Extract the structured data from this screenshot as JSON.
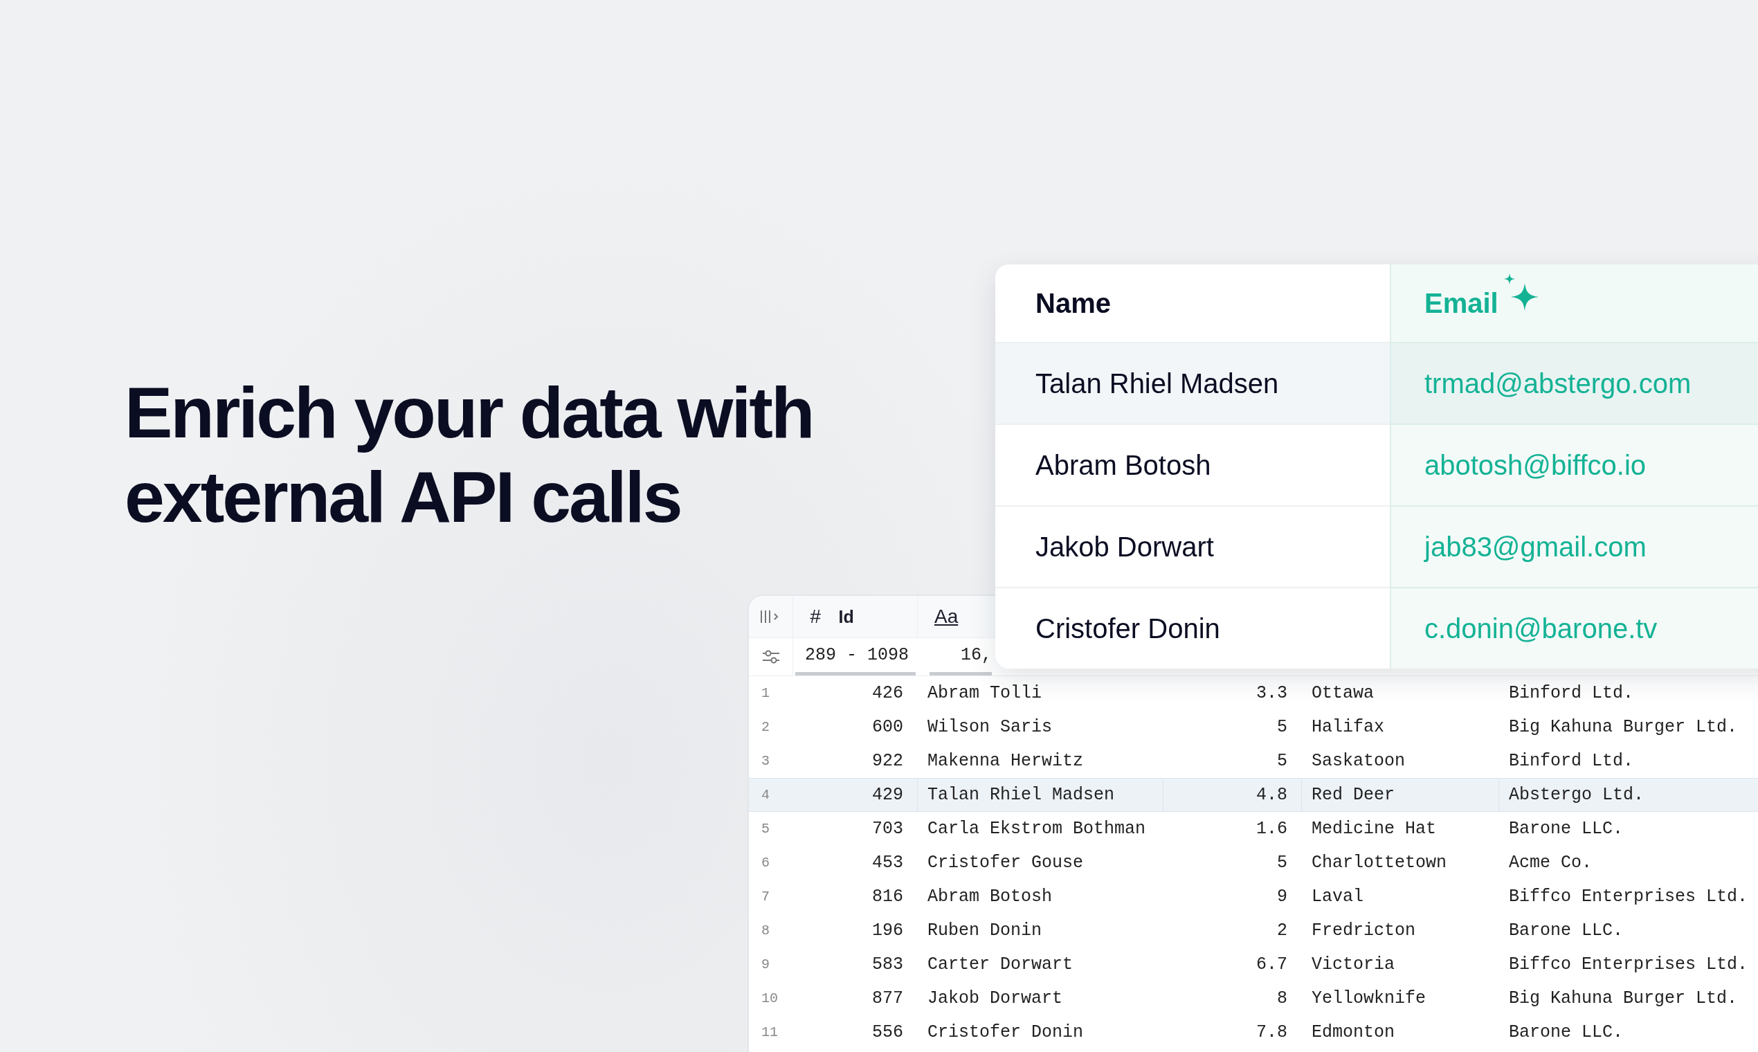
{
  "headline": [
    "Enrich your data with",
    "external API calls"
  ],
  "grid": {
    "header": [
      {
        "kind": "number",
        "type_glyph": "#",
        "label": "Id"
      },
      {
        "kind": "text",
        "type_glyph": "Aa"
      }
    ],
    "filters": [
      "289 - 1098",
      "16,"
    ],
    "rows": [
      {
        "index": "1",
        "id": "426",
        "name": "Abram Tolli",
        "value": "3.3",
        "city": "Ottawa",
        "company": "Binford Ltd.",
        "selected": false
      },
      {
        "index": "2",
        "id": "600",
        "name": "Wilson Saris",
        "value": "5",
        "city": "Halifax",
        "company": "Big Kahuna Burger Ltd.",
        "selected": false
      },
      {
        "index": "3",
        "id": "922",
        "name": "Makenna Herwitz",
        "value": "5",
        "city": "Saskatoon",
        "company": "Binford Ltd.",
        "selected": false
      },
      {
        "index": "4",
        "id": "429",
        "name": "Talan Rhiel Madsen",
        "value": "4.8",
        "city": "Red Deer",
        "company": "Abstergo Ltd.",
        "selected": true
      },
      {
        "index": "5",
        "id": "703",
        "name": "Carla Ekstrom Bothman",
        "value": "1.6",
        "city": "Medicine Hat",
        "company": "Barone LLC.",
        "selected": false
      },
      {
        "index": "6",
        "id": "453",
        "name": "Cristofer Gouse",
        "value": "5",
        "city": "Charlottetown",
        "company": "Acme Co.",
        "selected": false
      },
      {
        "index": "7",
        "id": "816",
        "name": "Abram Botosh",
        "value": "9",
        "city": "Laval",
        "company": "Biffco Enterprises Ltd.",
        "selected": false
      },
      {
        "index": "8",
        "id": "196",
        "name": "Ruben Donin",
        "value": "2",
        "city": "Fredricton",
        "company": "Barone LLC.",
        "selected": false
      },
      {
        "index": "9",
        "id": "583",
        "name": "Carter Dorwart",
        "value": "6.7",
        "city": "Victoria",
        "company": "Biffco Enterprises Ltd.",
        "selected": false
      },
      {
        "index": "10",
        "id": "877",
        "name": "Jakob Dorwart",
        "value": "8",
        "city": "Yellowknife",
        "company": "Big Kahuna Burger Ltd.",
        "selected": false
      },
      {
        "index": "11",
        "id": "556",
        "name": "Cristofer Donin",
        "value": "7.8",
        "city": "Edmonton",
        "company": "Barone LLC.",
        "selected": false
      }
    ]
  },
  "enrichment_card": {
    "columns": [
      {
        "label": "Name",
        "kind": "source"
      },
      {
        "label": "Email",
        "kind": "enriched"
      }
    ],
    "rows": [
      {
        "name": "Talan Rhiel Madsen",
        "email": "trmad@abstergo.com",
        "selected": true
      },
      {
        "name": "Abram Botosh",
        "email": "abotosh@biffco.io",
        "selected": false
      },
      {
        "name": "Jakob Dorwart",
        "email": "jab83@gmail.com",
        "selected": false
      },
      {
        "name": "Cristofer Donin",
        "email": "c.donin@barone.tv",
        "selected": false
      }
    ]
  }
}
